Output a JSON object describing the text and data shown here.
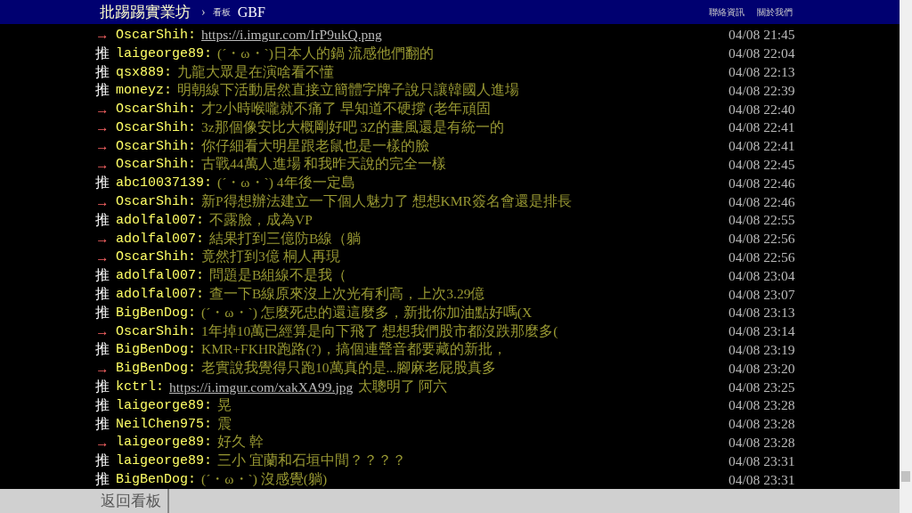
{
  "header": {
    "site": "批踢踢實業坊",
    "separator": "›",
    "board_label": "看板",
    "board": "GBF",
    "links": [
      "聯絡資訊",
      "關於我們"
    ]
  },
  "comments": [
    {
      "kind": "arrow",
      "tag": "→",
      "user": "OscarShih:",
      "content": [
        {
          "kind": "link",
          "text": "https://i.imgur.com/IrP9ukQ.png"
        }
      ],
      "time": "04/08 21:45"
    },
    {
      "kind": "push",
      "tag": "推",
      "user": "laigeorge89:",
      "content": [
        {
          "kind": "text",
          "text": "(´・ω・`)日本人的鍋 流感他們翻的"
        }
      ],
      "time": "04/08 22:04"
    },
    {
      "kind": "push",
      "tag": "推",
      "user": "qsx889:",
      "content": [
        {
          "kind": "text",
          "text": "九龍大眾是在演啥看不懂"
        }
      ],
      "time": "04/08 22:13"
    },
    {
      "kind": "push",
      "tag": "推",
      "user": "moneyz:",
      "content": [
        {
          "kind": "text",
          "text": "明朝線下活動居然直接立簡體字牌子說只讓韓國人進場"
        }
      ],
      "time": "04/08 22:39"
    },
    {
      "kind": "arrow",
      "tag": "→",
      "user": "OscarShih:",
      "content": [
        {
          "kind": "text",
          "text": "才2小時喉嚨就不痛了 早知道不硬撐 (老年頑固"
        }
      ],
      "time": "04/08 22:40"
    },
    {
      "kind": "arrow",
      "tag": "→",
      "user": "OscarShih:",
      "content": [
        {
          "kind": "text",
          "text": "3z那個像安比大概剛好吧 3Z的畫風還是有統一的"
        }
      ],
      "time": "04/08 22:41"
    },
    {
      "kind": "arrow",
      "tag": "→",
      "user": "OscarShih:",
      "content": [
        {
          "kind": "text",
          "text": "你仔細看大明星跟老鼠也是一樣的臉"
        }
      ],
      "time": "04/08 22:41"
    },
    {
      "kind": "arrow",
      "tag": "→",
      "user": "OscarShih:",
      "content": [
        {
          "kind": "text",
          "text": "古戰44萬人進場 和我昨天說的完全一樣"
        }
      ],
      "time": "04/08 22:45"
    },
    {
      "kind": "push",
      "tag": "推",
      "user": "abc10037139:",
      "content": [
        {
          "kind": "text",
          "text": "(´・ω・`) 4年後一定島"
        }
      ],
      "time": "04/08 22:46"
    },
    {
      "kind": "arrow",
      "tag": "→",
      "user": "OscarShih:",
      "content": [
        {
          "kind": "text",
          "text": "新P得想辦法建立一下個人魅力了 想想KMR簽名會還是排長"
        }
      ],
      "time": "04/08 22:46"
    },
    {
      "kind": "push",
      "tag": "推",
      "user": "adolfal007:",
      "content": [
        {
          "kind": "text",
          "text": "不露臉，成為VP"
        }
      ],
      "time": "04/08 22:55"
    },
    {
      "kind": "arrow",
      "tag": "→",
      "user": "adolfal007:",
      "content": [
        {
          "kind": "text",
          "text": "結果打到三億防B線（躺"
        }
      ],
      "time": "04/08 22:56"
    },
    {
      "kind": "arrow",
      "tag": "→",
      "user": "OscarShih:",
      "content": [
        {
          "kind": "text",
          "text": "竟然打到3億 桐人再現"
        }
      ],
      "time": "04/08 22:56"
    },
    {
      "kind": "push",
      "tag": "推",
      "user": "adolfal007:",
      "content": [
        {
          "kind": "text",
          "text": "問題是B組線不是我（"
        }
      ],
      "time": "04/08 23:04"
    },
    {
      "kind": "push",
      "tag": "推",
      "user": "adolfal007:",
      "content": [
        {
          "kind": "text",
          "text": "查一下B線原來沒上次光有利高，上次3.29億"
        }
      ],
      "time": "04/08 23:07"
    },
    {
      "kind": "push",
      "tag": "推",
      "user": "BigBenDog:",
      "content": [
        {
          "kind": "text",
          "text": "(´・ω・`) 怎麼死忠的還這麼多，新批你加油點好嗎(X"
        }
      ],
      "time": "04/08 23:13"
    },
    {
      "kind": "arrow",
      "tag": "→",
      "user": "OscarShih:",
      "content": [
        {
          "kind": "text",
          "text": "1年掉10萬已經算是向下飛了 想想我們股市都沒跌那麼多("
        }
      ],
      "time": "04/08 23:14"
    },
    {
      "kind": "push",
      "tag": "推",
      "user": "BigBenDog:",
      "content": [
        {
          "kind": "text",
          "text": "KMR+FKHR跑路(?)，搞個連聲音都要藏的新批，"
        }
      ],
      "time": "04/08 23:19"
    },
    {
      "kind": "arrow",
      "tag": "→",
      "user": "BigBenDog:",
      "content": [
        {
          "kind": "text",
          "text": "老實說我覺得只跑10萬真的是...腳麻老屁股真多"
        }
      ],
      "time": "04/08 23:20"
    },
    {
      "kind": "push",
      "tag": "推",
      "user": "kctrl:",
      "content": [
        {
          "kind": "link",
          "text": "https://i.imgur.com/xakXA99.jpg"
        },
        {
          "kind": "text",
          "text": "太聰明了 阿六"
        }
      ],
      "time": "04/08 23:25"
    },
    {
      "kind": "push",
      "tag": "推",
      "user": "laigeorge89:",
      "content": [
        {
          "kind": "text",
          "text": "晃"
        }
      ],
      "time": "04/08 23:28"
    },
    {
      "kind": "push",
      "tag": "推",
      "user": "NeilChen975:",
      "content": [
        {
          "kind": "text",
          "text": "震"
        }
      ],
      "time": "04/08 23:28"
    },
    {
      "kind": "arrow",
      "tag": "→",
      "user": "laigeorge89:",
      "content": [
        {
          "kind": "text",
          "text": "好久 幹"
        }
      ],
      "time": "04/08 23:28"
    },
    {
      "kind": "push",
      "tag": "推",
      "user": "laigeorge89:",
      "content": [
        {
          "kind": "text",
          "text": "三小 宜蘭和石垣中間？？？？"
        }
      ],
      "time": "04/08 23:31"
    },
    {
      "kind": "push",
      "tag": "推",
      "user": "BigBenDog:",
      "content": [
        {
          "kind": "text",
          "text": "(´・ω・`) 沒感覺(躺)"
        }
      ],
      "time": "04/08 23:31"
    }
  ],
  "footer": {
    "back_button": "返回看板"
  }
}
